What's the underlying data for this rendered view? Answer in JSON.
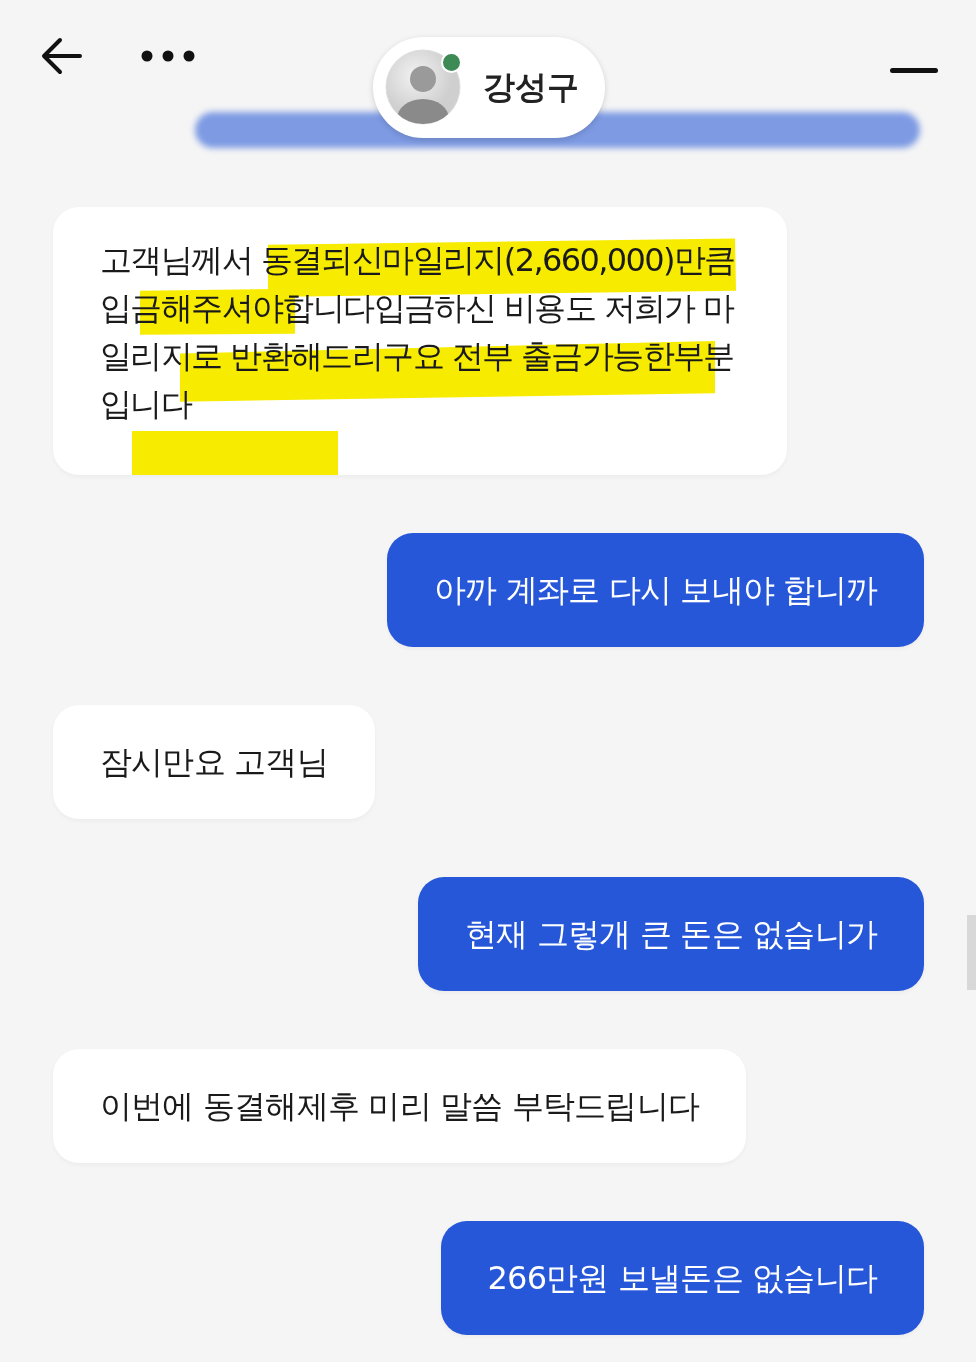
{
  "contact": {
    "name": "강성구",
    "online": true
  },
  "messages": [
    {
      "kind": "received",
      "text": "고객님께서 동결되신마일리지(2,660,000)만큼 입금해주셔야합니다입금하신 비용도 저희가 마일리지로 반환해드리구요 전부 출금가능한부분입니다",
      "highlighted": true
    },
    {
      "kind": "sent",
      "text": "아까 계좌로 다시 보내야 합니까",
      "highlighted": false
    },
    {
      "kind": "received",
      "text": "잠시만요 고객님",
      "highlighted": false
    },
    {
      "kind": "sent",
      "text": "현재 그렇개 큰 돈은 없습니가",
      "highlighted": false
    },
    {
      "kind": "received",
      "text": "이번에 동결해제후 미리 말씀 부탁드립니다",
      "highlighted": false
    },
    {
      "kind": "sent",
      "text": "266만원 보낼돈은 없습니다",
      "highlighted": false
    }
  ]
}
